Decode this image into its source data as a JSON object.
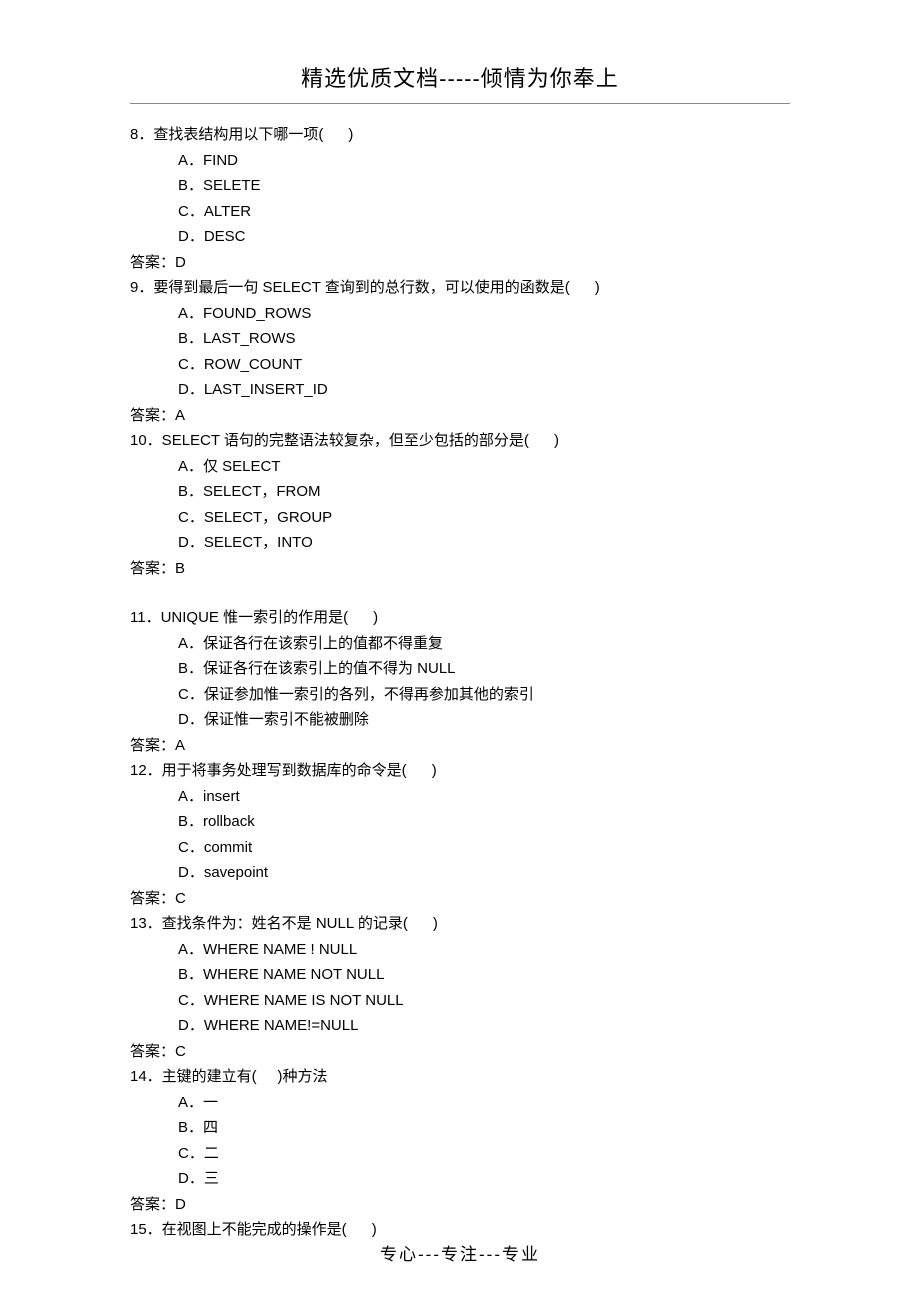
{
  "header": {
    "title": "精选优质文档-----倾情为你奉上"
  },
  "questions": [
    {
      "number": "8",
      "stem_prefix": "8．查找表结构用以下哪一项(",
      "stem_suffix": ")",
      "options": [
        {
          "label": "A．FIND"
        },
        {
          "label": "B．SELETE"
        },
        {
          "label": "C．ALTER"
        },
        {
          "label": "D．DESC"
        }
      ],
      "answer": "答案：D"
    },
    {
      "number": "9",
      "stem_prefix": "9．要得到最后一句 SELECT 查询到的总行数，可以使用的函数是(",
      "stem_suffix": ")",
      "options": [
        {
          "label": "A．FOUND_ROWS"
        },
        {
          "label": "B．LAST_ROWS"
        },
        {
          "label": "C．ROW_COUNT"
        },
        {
          "label": "D．LAST_INSERT_ID"
        }
      ],
      "answer": "答案：A"
    },
    {
      "number": "10",
      "stem_prefix": "10．SELECT 语句的完整语法较复杂，但至少包括的部分是(",
      "stem_suffix": ")",
      "options": [
        {
          "label": "A．仅 SELECT"
        },
        {
          "label": "B．SELECT，FROM"
        },
        {
          "label": "C．SELECT，GROUP"
        },
        {
          "label": "D．SELECT，INTO"
        }
      ],
      "answer": "答案：B"
    },
    {
      "number": "11",
      "stem_prefix": "11．UNIQUE 惟一索引的作用是(",
      "stem_suffix": ")",
      "options": [
        {
          "label": "A．保证各行在该索引上的值都不得重复"
        },
        {
          "label": "B．保证各行在该索引上的值不得为 NULL"
        },
        {
          "label": "C．保证参加惟一索引的各列，不得再参加其他的索引"
        },
        {
          "label": "D．保证惟一索引不能被删除"
        }
      ],
      "answer": "答案：A"
    },
    {
      "number": "12",
      "stem_prefix": "12．用于将事务处理写到数据库的命令是(",
      "stem_suffix": ")",
      "options": [
        {
          "label": "A．insert"
        },
        {
          "label": "B．rollback"
        },
        {
          "label": "C．commit"
        },
        {
          "label": "D．savepoint"
        }
      ],
      "answer": "答案：C"
    },
    {
      "number": "13",
      "stem_prefix": "13．查找条件为：姓名不是 NULL 的记录(",
      "stem_suffix": ")",
      "options": [
        {
          "label": "A．WHERE NAME ! NULL"
        },
        {
          "label": "B．WHERE NAME NOT NULL"
        },
        {
          "label": "C．WHERE NAME IS NOT NULL"
        },
        {
          "label": "D．WHERE NAME!=NULL"
        }
      ],
      "answer": "答案：C"
    },
    {
      "number": "14",
      "stem_prefix": "14．主键的建立有(",
      "stem_suffix": ")种方法",
      "options": [
        {
          "label": "A．一"
        },
        {
          "label": "B．四"
        },
        {
          "label": "C．二"
        },
        {
          "label": "D．三"
        }
      ],
      "answer": "答案：D"
    },
    {
      "number": "15",
      "stem_prefix": "15．在视图上不能完成的操作是(",
      "stem_suffix": ")",
      "options": [],
      "answer": ""
    }
  ],
  "footer": {
    "text": "专心---专注---专业"
  }
}
